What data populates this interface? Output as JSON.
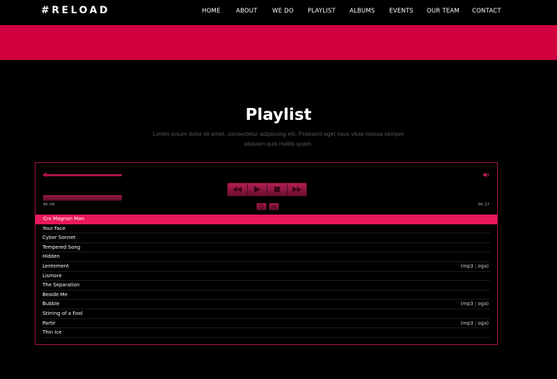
{
  "header": {
    "logo": "#RELOAD",
    "nav": [
      "HOME",
      "ABOUT",
      "WE DO",
      "PLAYLIST",
      "ALBUMS",
      "EVENTS",
      "OUR TEAM",
      "CONTACT"
    ]
  },
  "section": {
    "title": "Playlist",
    "subtitle": "Lorem ipsum dolor sit amet, consectetur adipiscing elit. Praesent eget risus vitae massa semper aliquam quis mattis quam."
  },
  "player": {
    "current_time": "00:00",
    "duration": "04:27",
    "volume_level": 1.0,
    "progress": 0,
    "tracks": [
      {
        "title": "Cro Magnon Man",
        "active": true,
        "formats": []
      },
      {
        "title": "Your Face",
        "active": false,
        "formats": []
      },
      {
        "title": "Cyber Sonnet",
        "active": false,
        "formats": []
      },
      {
        "title": "Tempered Song",
        "active": false,
        "formats": []
      },
      {
        "title": "Hidden",
        "active": false,
        "formats": []
      },
      {
        "title": "Lentement",
        "active": false,
        "formats": [
          "mp3",
          "oga"
        ]
      },
      {
        "title": "Lismore",
        "active": false,
        "formats": []
      },
      {
        "title": "The Separation",
        "active": false,
        "formats": []
      },
      {
        "title": "Beside Me",
        "active": false,
        "formats": []
      },
      {
        "title": "Bubble",
        "active": false,
        "formats": [
          "mp3",
          "oga"
        ]
      },
      {
        "title": "Stirring of a Fool",
        "active": false,
        "formats": []
      },
      {
        "title": "Partir",
        "active": false,
        "formats": [
          "mp3",
          "oga"
        ]
      },
      {
        "title": "Thin Ice",
        "active": false,
        "formats": []
      }
    ]
  },
  "colors": {
    "accent": "#d1003f",
    "active_track": "#e8195a",
    "border": "#b0124a"
  },
  "icons": {
    "mute": "speaker-mute-icon",
    "max_volume": "speaker-max-icon",
    "previous": "rewind-icon",
    "play": "play-icon",
    "stop": "stop-icon",
    "next": "fast-forward-icon",
    "repeat": "repeat-icon",
    "shuffle": "shuffle-icon"
  }
}
